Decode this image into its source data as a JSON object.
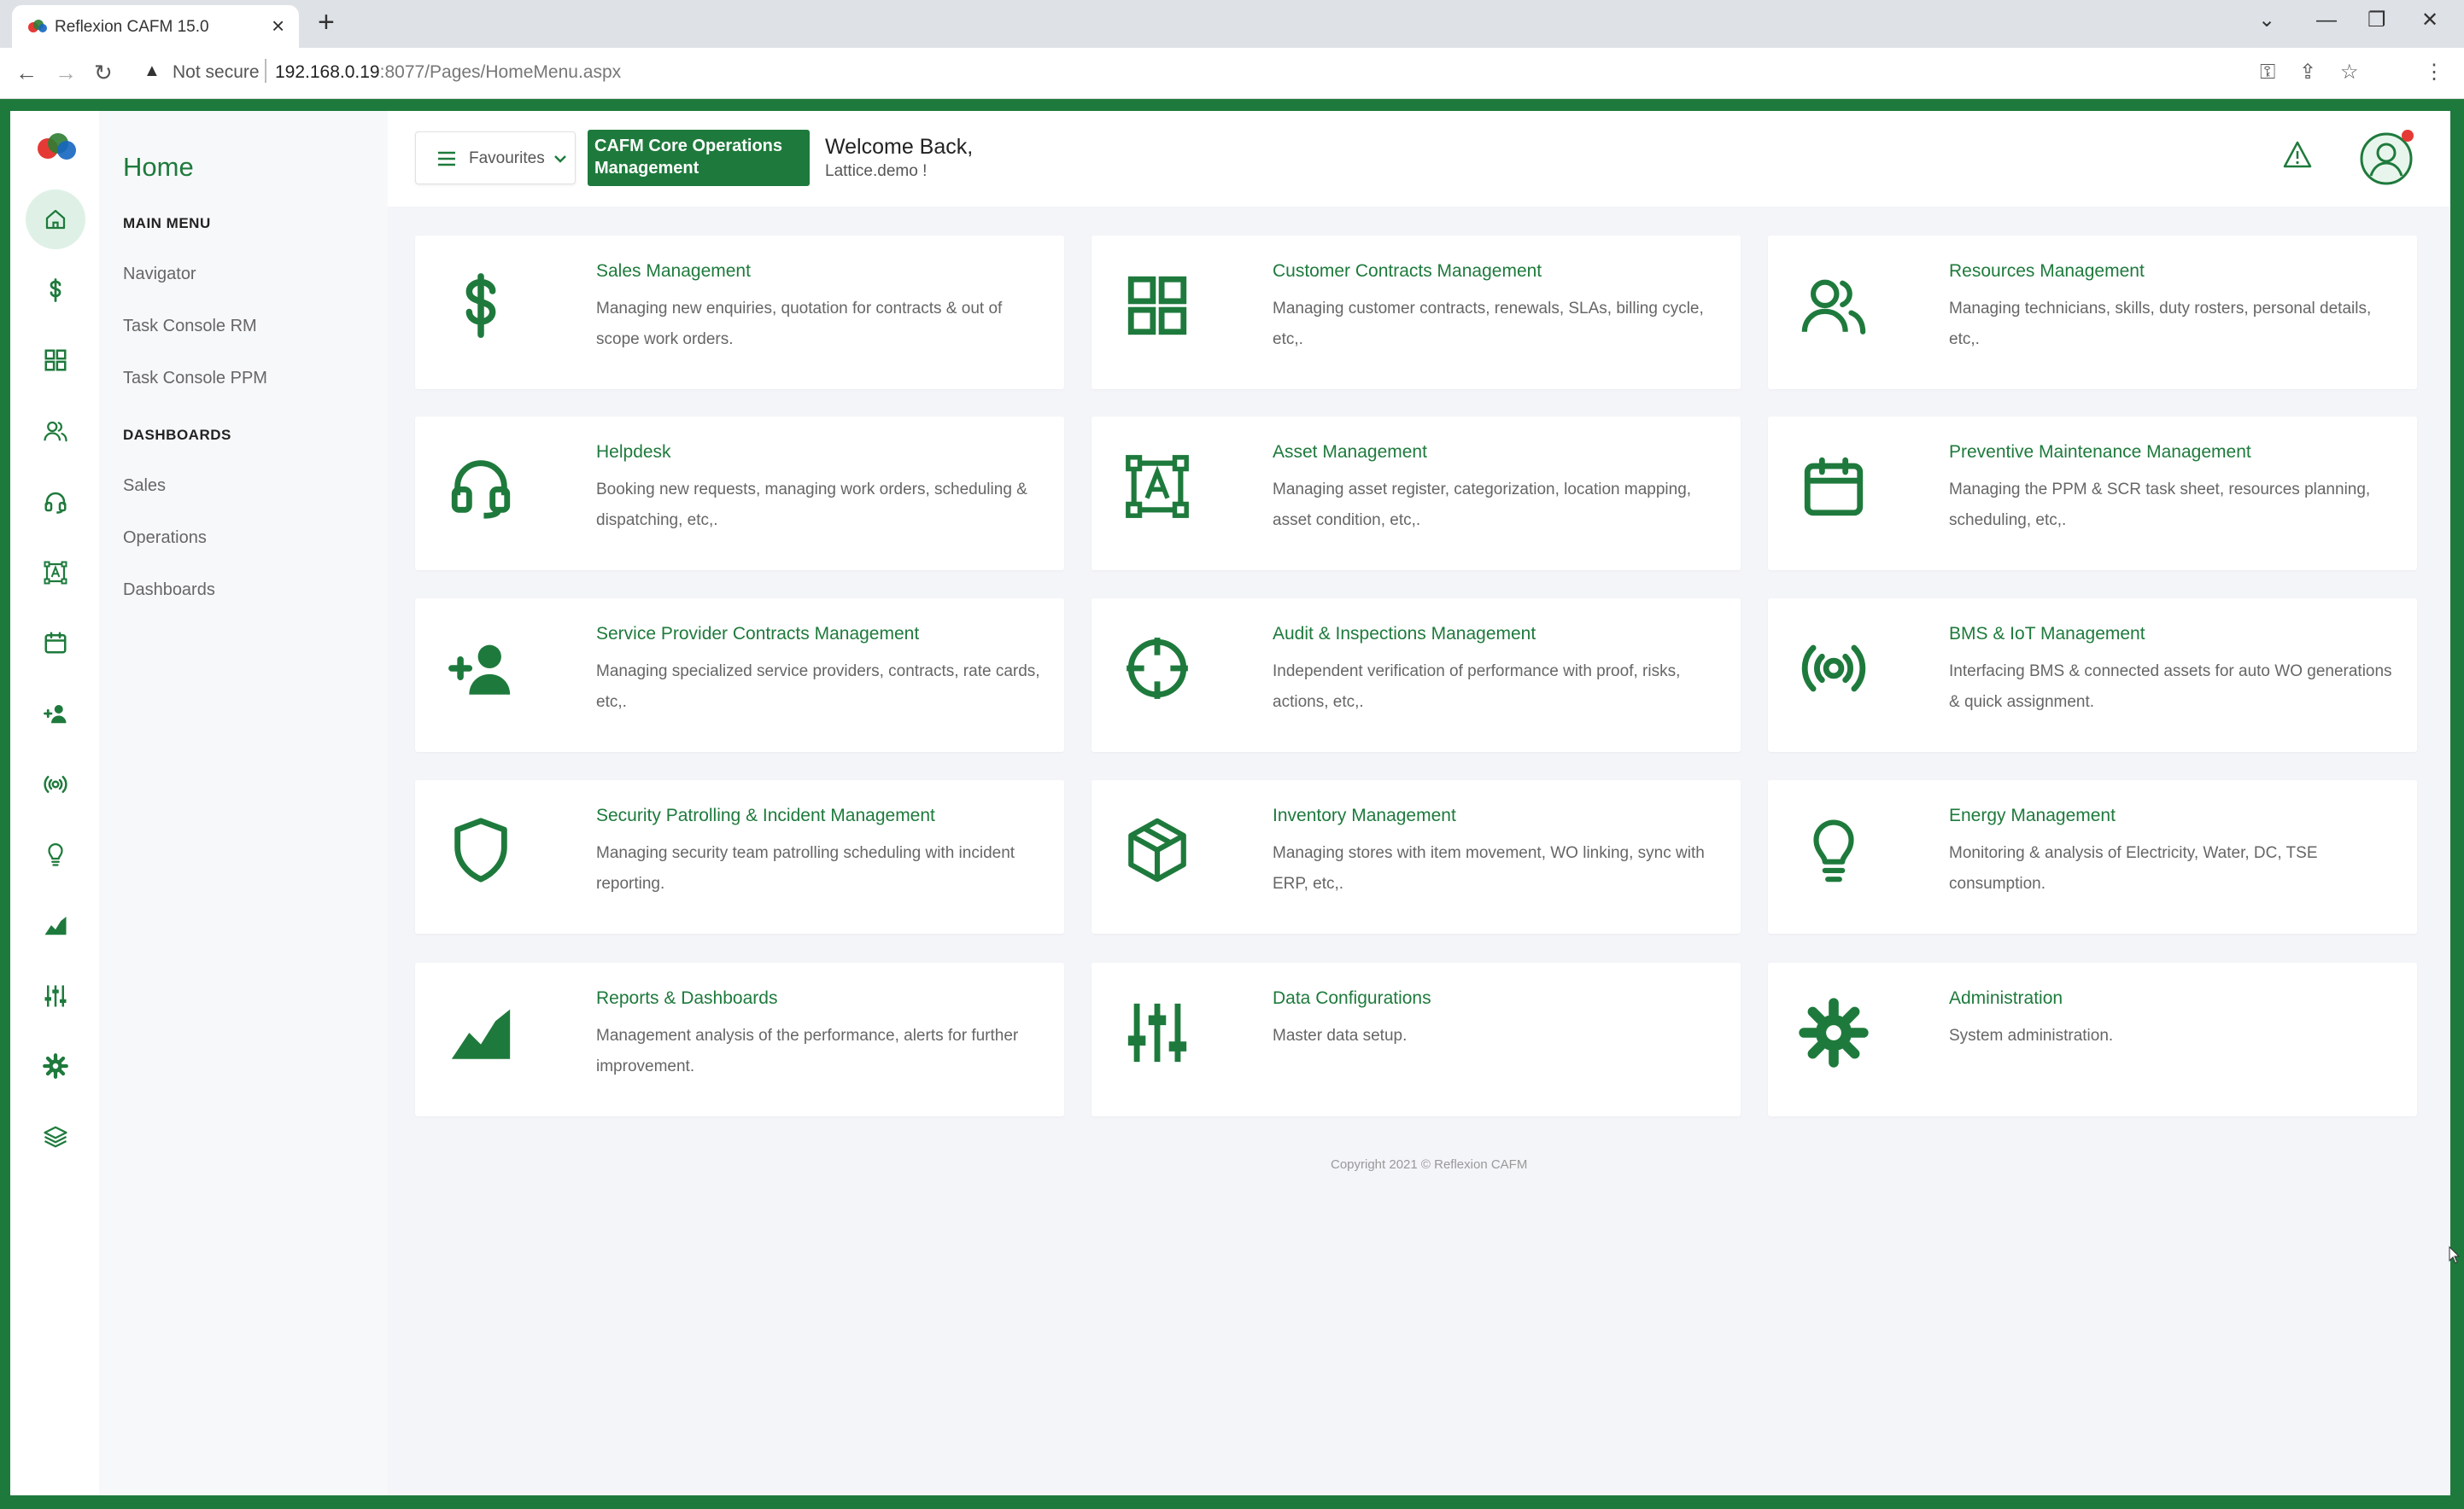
{
  "browser": {
    "tab_title": "Reflexion CAFM 15.0",
    "security_label": "Not secure",
    "url_host": "192.168.0.19",
    "url_path": ":8077/Pages/HomeMenu.aspx"
  },
  "menu": {
    "title": "Home",
    "main_heading": "MAIN MENU",
    "main_items": [
      "Navigator",
      "Task Console RM",
      "Task Console PPM"
    ],
    "dashboards_heading": "DASHBOARDS",
    "dashboard_items": [
      "Sales",
      "Operations",
      "Dashboards"
    ]
  },
  "icon_rail": [
    "home-icon",
    "dollar-icon",
    "grid-icon",
    "users-icon",
    "headset-icon",
    "asset-icon",
    "calendar-icon",
    "user-plus-icon",
    "broadcast-icon",
    "bulb-icon",
    "chart-area-icon",
    "sliders-icon",
    "gear-icon",
    "layers-icon"
  ],
  "topbar": {
    "favourites_label": "Favourites",
    "module_label": "CAFM Core Operations Management",
    "welcome_text": "Welcome Back,",
    "user_text": "Lattice.demo !"
  },
  "colors": {
    "brand": "#1e7a3c",
    "accent_light": "#dff1e6",
    "background": "#f4f5f9",
    "notification": "#e53935"
  },
  "cards": [
    {
      "title": "Sales Management",
      "description": "Managing new enquiries, quotation for contracts & out of scope work orders.",
      "icon": "dollar-icon"
    },
    {
      "title": "Customer Contracts Management",
      "description": "Managing customer contracts, renewals, SLAs, billing cycle, etc,.",
      "icon": "grid-icon"
    },
    {
      "title": "Resources Management",
      "description": "Managing technicians, skills, duty rosters, personal details, etc,.",
      "icon": "users-icon"
    },
    {
      "title": "Helpdesk",
      "description": "Booking new requests, managing work orders, scheduling & dispatching, etc,.",
      "icon": "headset-icon"
    },
    {
      "title": "Asset Management",
      "description": "Managing asset register, categorization, location mapping, asset condition, etc,.",
      "icon": "asset-icon"
    },
    {
      "title": "Preventive Maintenance Management",
      "description": "Managing the PPM & SCR task sheet, resources planning, scheduling, etc,.",
      "icon": "calendar-icon"
    },
    {
      "title": "Service Provider Contracts Management",
      "description": "Managing specialized service providers, contracts, rate cards, etc,.",
      "icon": "user-plus-icon"
    },
    {
      "title": "Audit & Inspections Management",
      "description": "Independent verification of performance with proof, risks, actions, etc,.",
      "icon": "crosshair-icon"
    },
    {
      "title": "BMS & IoT Management",
      "description": "Interfacing BMS & connected assets for auto WO generations & quick assignment.",
      "icon": "broadcast-icon"
    },
    {
      "title": "Security Patrolling & Incident Management",
      "description": "Managing security team patrolling scheduling with incident reporting.",
      "icon": "shield-icon"
    },
    {
      "title": "Inventory Management",
      "description": "Managing stores with item movement, WO linking, sync with ERP, etc,.",
      "icon": "box-icon"
    },
    {
      "title": "Energy Management",
      "description": "Monitoring & analysis of Electricity, Water, DC, TSE consumption.",
      "icon": "bulb-icon"
    },
    {
      "title": "Reports & Dashboards",
      "description": "Management analysis of the performance, alerts for further improvement.",
      "icon": "chart-area-icon"
    },
    {
      "title": "Data Configurations",
      "description": "Master data setup.",
      "icon": "sliders-icon"
    },
    {
      "title": "Administration",
      "description": "System administration.",
      "icon": "gear-icon"
    }
  ],
  "footer": {
    "copyright": "Copyright 2021 © Reflexion CAFM"
  }
}
